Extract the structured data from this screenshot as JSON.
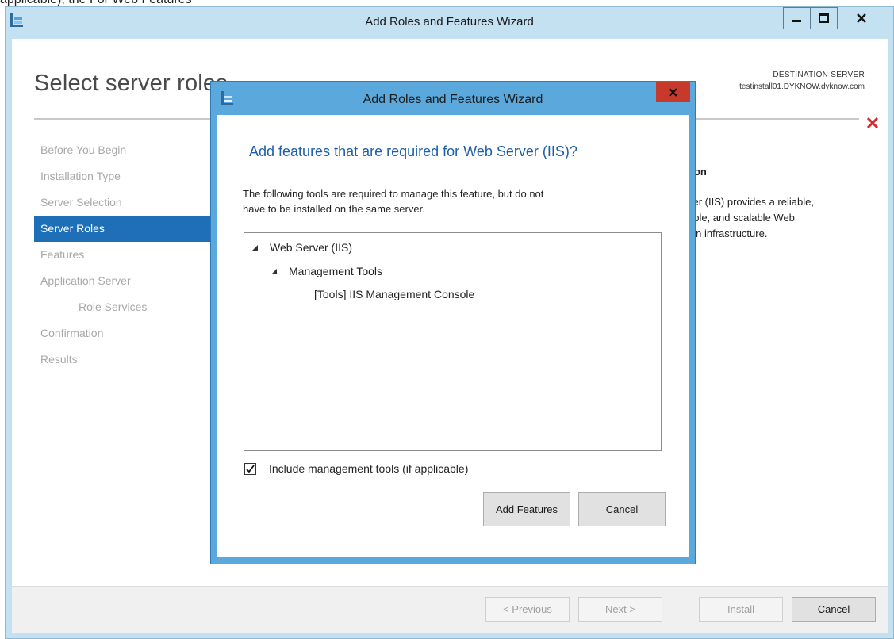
{
  "top_clipped_text": "applicable), the For Web Features",
  "window": {
    "title": "Add Roles and Features Wizard",
    "controls": [
      "minimize-button",
      "maximize-button",
      "close-button"
    ]
  },
  "page": {
    "title": "Select server roles",
    "destination_label": "DESTINATION SERVER",
    "destination_name": "testinstall01.DYKNOW.dyknow.com"
  },
  "nav": {
    "items": [
      {
        "label": "Before You Begin",
        "state": "disabled"
      },
      {
        "label": "Installation Type",
        "state": "disabled"
      },
      {
        "label": "Server Selection",
        "state": "disabled"
      },
      {
        "label": "Server Roles",
        "state": "active"
      },
      {
        "label": "Features",
        "state": "disabled"
      },
      {
        "label": "Application Server",
        "state": "disabled"
      },
      {
        "label": "Role Services",
        "state": "disabled"
      },
      {
        "label": "Confirmation",
        "state": "disabled"
      },
      {
        "label": "Results",
        "state": "disabled"
      }
    ]
  },
  "description": {
    "heading": "tion",
    "lines": [
      "ver (IIS) provides a reliable,",
      "able, and scalable Web",
      "ion infrastructure."
    ]
  },
  "footer": {
    "previous_label": "< Previous",
    "next_label": "Next >",
    "install_label": "Install",
    "cancel_label": "Cancel"
  },
  "dialog": {
    "title": "Add Roles and Features Wizard",
    "heading": "Add features that are required for Web Server (IIS)?",
    "text_line1": "The following tools are required to manage this feature, but do not",
    "text_line2": "have to be installed on the same server.",
    "tree": [
      {
        "label": "Web Server (IIS)",
        "expanded": true
      },
      {
        "label": "Management Tools",
        "expanded": true
      },
      {
        "label": "[Tools] IIS Management Console",
        "expanded": false
      }
    ],
    "include_tools_label": "Include management tools (if applicable)",
    "include_tools_checked": true,
    "add_features_label": "Add Features",
    "cancel_label": "Cancel"
  },
  "colors": {
    "window_frame": "#c4e1f2",
    "dialog_frame": "#5aa8dc",
    "accent": "#1e6fb8",
    "heading_blue": "#1e5fa8",
    "close_red": "#c7392b",
    "error_red": "#d9262a"
  }
}
